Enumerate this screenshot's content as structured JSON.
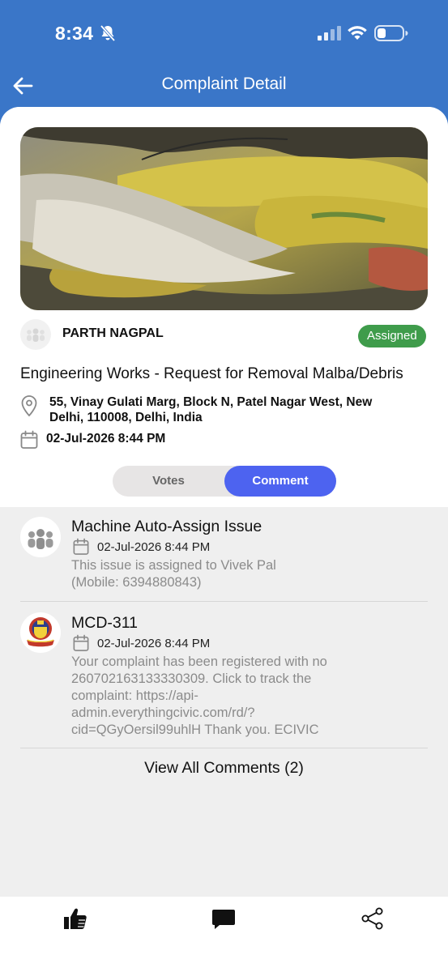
{
  "status_bar": {
    "time": "8:34"
  },
  "nav": {
    "title": "Complaint Detail"
  },
  "complaint": {
    "user_name": "PARTH NAGPAL",
    "status": "Assigned",
    "title": "Engineering Works - Request for Removal Malba/Debris",
    "address": "55, Vinay Gulati Marg, Block N, Patel Nagar West, New Delhi, 110008, Delhi, India",
    "date": "02-Jul-2026 8:44 PM"
  },
  "tabs": [
    {
      "label": "Votes",
      "active": false
    },
    {
      "label": "Comment",
      "active": true
    }
  ],
  "comments": [
    {
      "author": "Machine Auto-Assign Issue",
      "date": "02-Jul-2026 8:44 PM",
      "body": "This issue is assigned to Vivek Pal (Mobile: 6394880843)"
    },
    {
      "author": "MCD-311",
      "date": "02-Jul-2026 8:44 PM",
      "body": "Your complaint has been registered with no 260702163133330309. Click to track the complaint: https://api-admin.everythingcivic.com/rd/?cid=QGyOersil99uhlH Thank you. ECIVIC"
    }
  ],
  "view_all_label": "View All Comments (2)",
  "bottom_bar": {
    "icons": [
      "thumbs-up-icon",
      "comment-icon",
      "share-icon"
    ]
  },
  "colors": {
    "header": "#3a76c8",
    "accent": "#4d63f0",
    "badge": "#3f9c4b"
  }
}
